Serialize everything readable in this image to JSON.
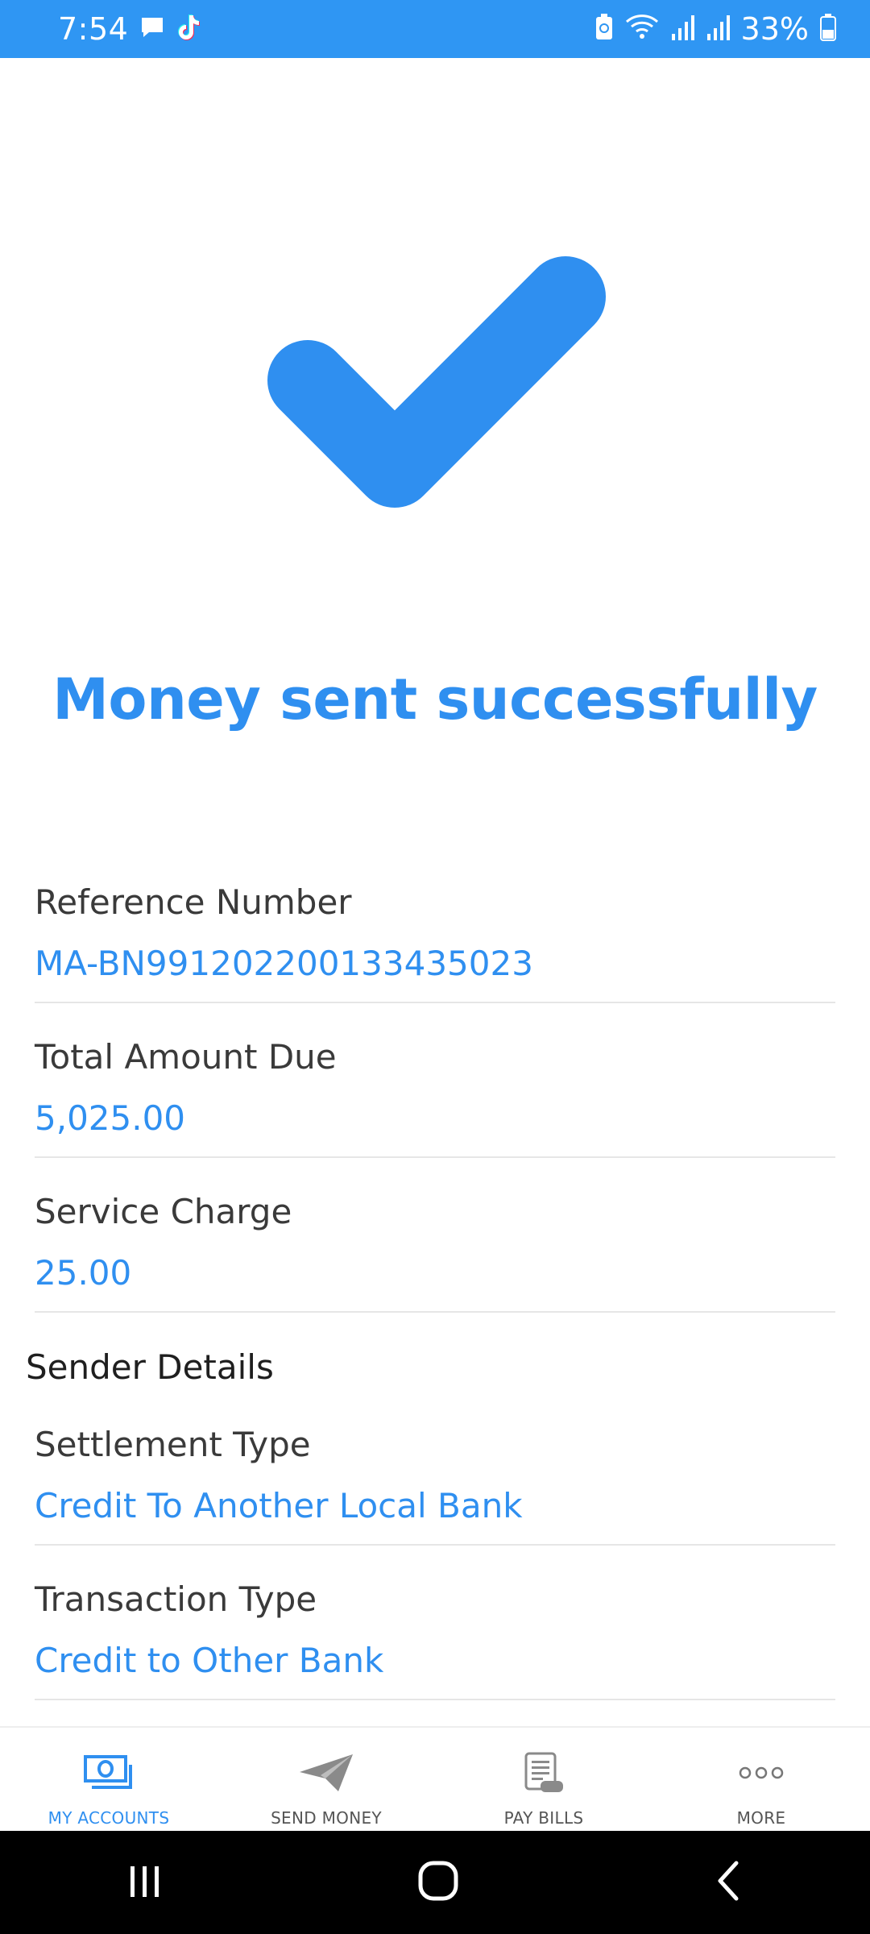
{
  "status_bar": {
    "time": "7:54",
    "battery_percent": "33%",
    "icons": [
      "chat-icon",
      "tiktok-icon",
      "battery-saver-icon",
      "wifi-icon",
      "signal-icon",
      "signal-icon",
      "battery-icon"
    ]
  },
  "colors": {
    "accent": "#2f8ff0",
    "status_bar": "#2f96f3"
  },
  "success": {
    "icon": "checkmark-icon",
    "title": "Money sent successfully"
  },
  "details": [
    {
      "label": "Reference Number",
      "value": "MA-BN991202200133435023"
    },
    {
      "label": "Total Amount Due",
      "value": "5,025.00"
    },
    {
      "label": "Service Charge",
      "value": "25.00"
    }
  ],
  "sender_section_title": "Sender Details",
  "sender": [
    {
      "label": "Settlement Type",
      "value": "Credit To Another Local Bank"
    },
    {
      "label": "Transaction Type",
      "value": "Credit to Other Bank"
    }
  ],
  "bottom_nav": [
    {
      "label": "MY ACCOUNTS",
      "icon": "money-icon",
      "active": true
    },
    {
      "label": "SEND MONEY",
      "icon": "paper-plane-icon",
      "active": false
    },
    {
      "label": "PAY BILLS",
      "icon": "bill-icon",
      "active": false
    },
    {
      "label": "MORE",
      "icon": "more-icon",
      "active": false
    }
  ],
  "system_nav": [
    "recents-icon",
    "home-icon",
    "back-icon"
  ]
}
